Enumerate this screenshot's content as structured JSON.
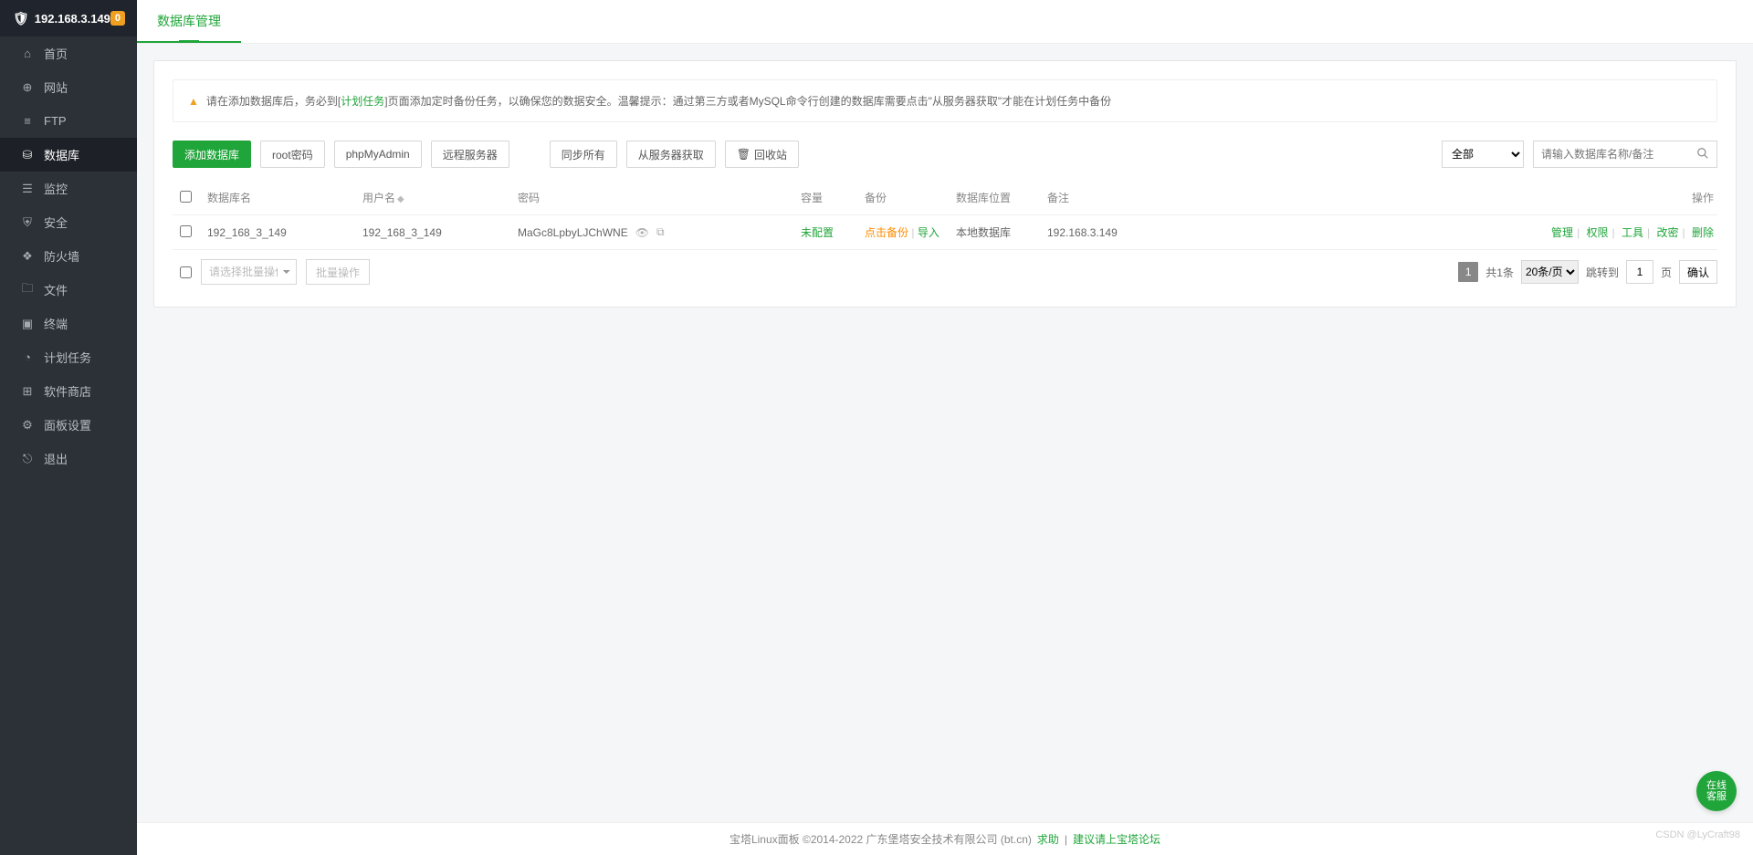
{
  "header": {
    "ip": "192.168.3.149",
    "badge": "0"
  },
  "sidebar": {
    "items": [
      {
        "icon": "⌂",
        "label": "首页"
      },
      {
        "icon": "⊕",
        "label": "网站"
      },
      {
        "icon": "≡",
        "label": "FTP"
      },
      {
        "icon": "⛁",
        "label": "数据库"
      },
      {
        "icon": "☰",
        "label": "监控"
      },
      {
        "icon": "⛨",
        "label": "安全"
      },
      {
        "icon": "❖",
        "label": "防火墙"
      },
      {
        "icon": "🗀",
        "label": "文件"
      },
      {
        "icon": "▣",
        "label": "终端"
      },
      {
        "icon": "◔",
        "label": "计划任务"
      },
      {
        "icon": "⊞",
        "label": "软件商店"
      },
      {
        "icon": "⚙",
        "label": "面板设置"
      },
      {
        "icon": "⎋",
        "label": "退出"
      }
    ],
    "active_index": 3
  },
  "tabs": {
    "active": "数据库管理"
  },
  "alert": {
    "prefix": "请在添加数据库后，务必到[",
    "link": "计划任务",
    "suffix": "]页面添加定时备份任务，以确保您的数据安全。温馨提示：通过第三方或者MySQL命令行创建的数据库需要点击\"从服务器获取\"才能在计划任务中备份"
  },
  "toolbar": {
    "add_db": "添加数据库",
    "root_pw": "root密码",
    "phpmyadmin": "phpMyAdmin",
    "remote": "远程服务器",
    "sync_all": "同步所有",
    "fetch_server": "从服务器获取",
    "recycle": "回收站",
    "filter_options": [
      "全部"
    ],
    "filter_selected": "全部",
    "search_placeholder": "请输入数据库名称/备注"
  },
  "table": {
    "headers": {
      "name": "数据库名",
      "user": "用户名",
      "password": "密码",
      "capacity": "容量",
      "backup": "备份",
      "location": "数据库位置",
      "remark": "备注",
      "ops": "操作"
    },
    "rows": [
      {
        "name": "192_168_3_149",
        "user": "192_168_3_149",
        "password": "MaGc8LpbyLJChWNE",
        "capacity": "未配置",
        "backup_click": "点击备份",
        "backup_import": "导入",
        "location": "本地数据库",
        "remark": "192.168.3.149",
        "ops": {
          "manage": "管理",
          "perm": "权限",
          "tool": "工具",
          "pw": "改密",
          "del": "删除"
        }
      }
    ]
  },
  "batch": {
    "select_placeholder": "请选择批量操作",
    "action": "批量操作"
  },
  "pagination": {
    "current": "1",
    "total_text": "共1条",
    "page_size": "20条/页",
    "jump_label": "跳转到",
    "jump_value": "1",
    "page_suffix": "页",
    "confirm": "确认"
  },
  "footer": {
    "product": "宝塔Linux面板 ©2014-2022 广东堡塔安全技术有限公司 (bt.cn)",
    "help": "求助",
    "sep": "|",
    "forum": "建议请上宝塔论坛"
  },
  "fab": "在线\n客服",
  "watermark": "CSDN @LyCraft98"
}
